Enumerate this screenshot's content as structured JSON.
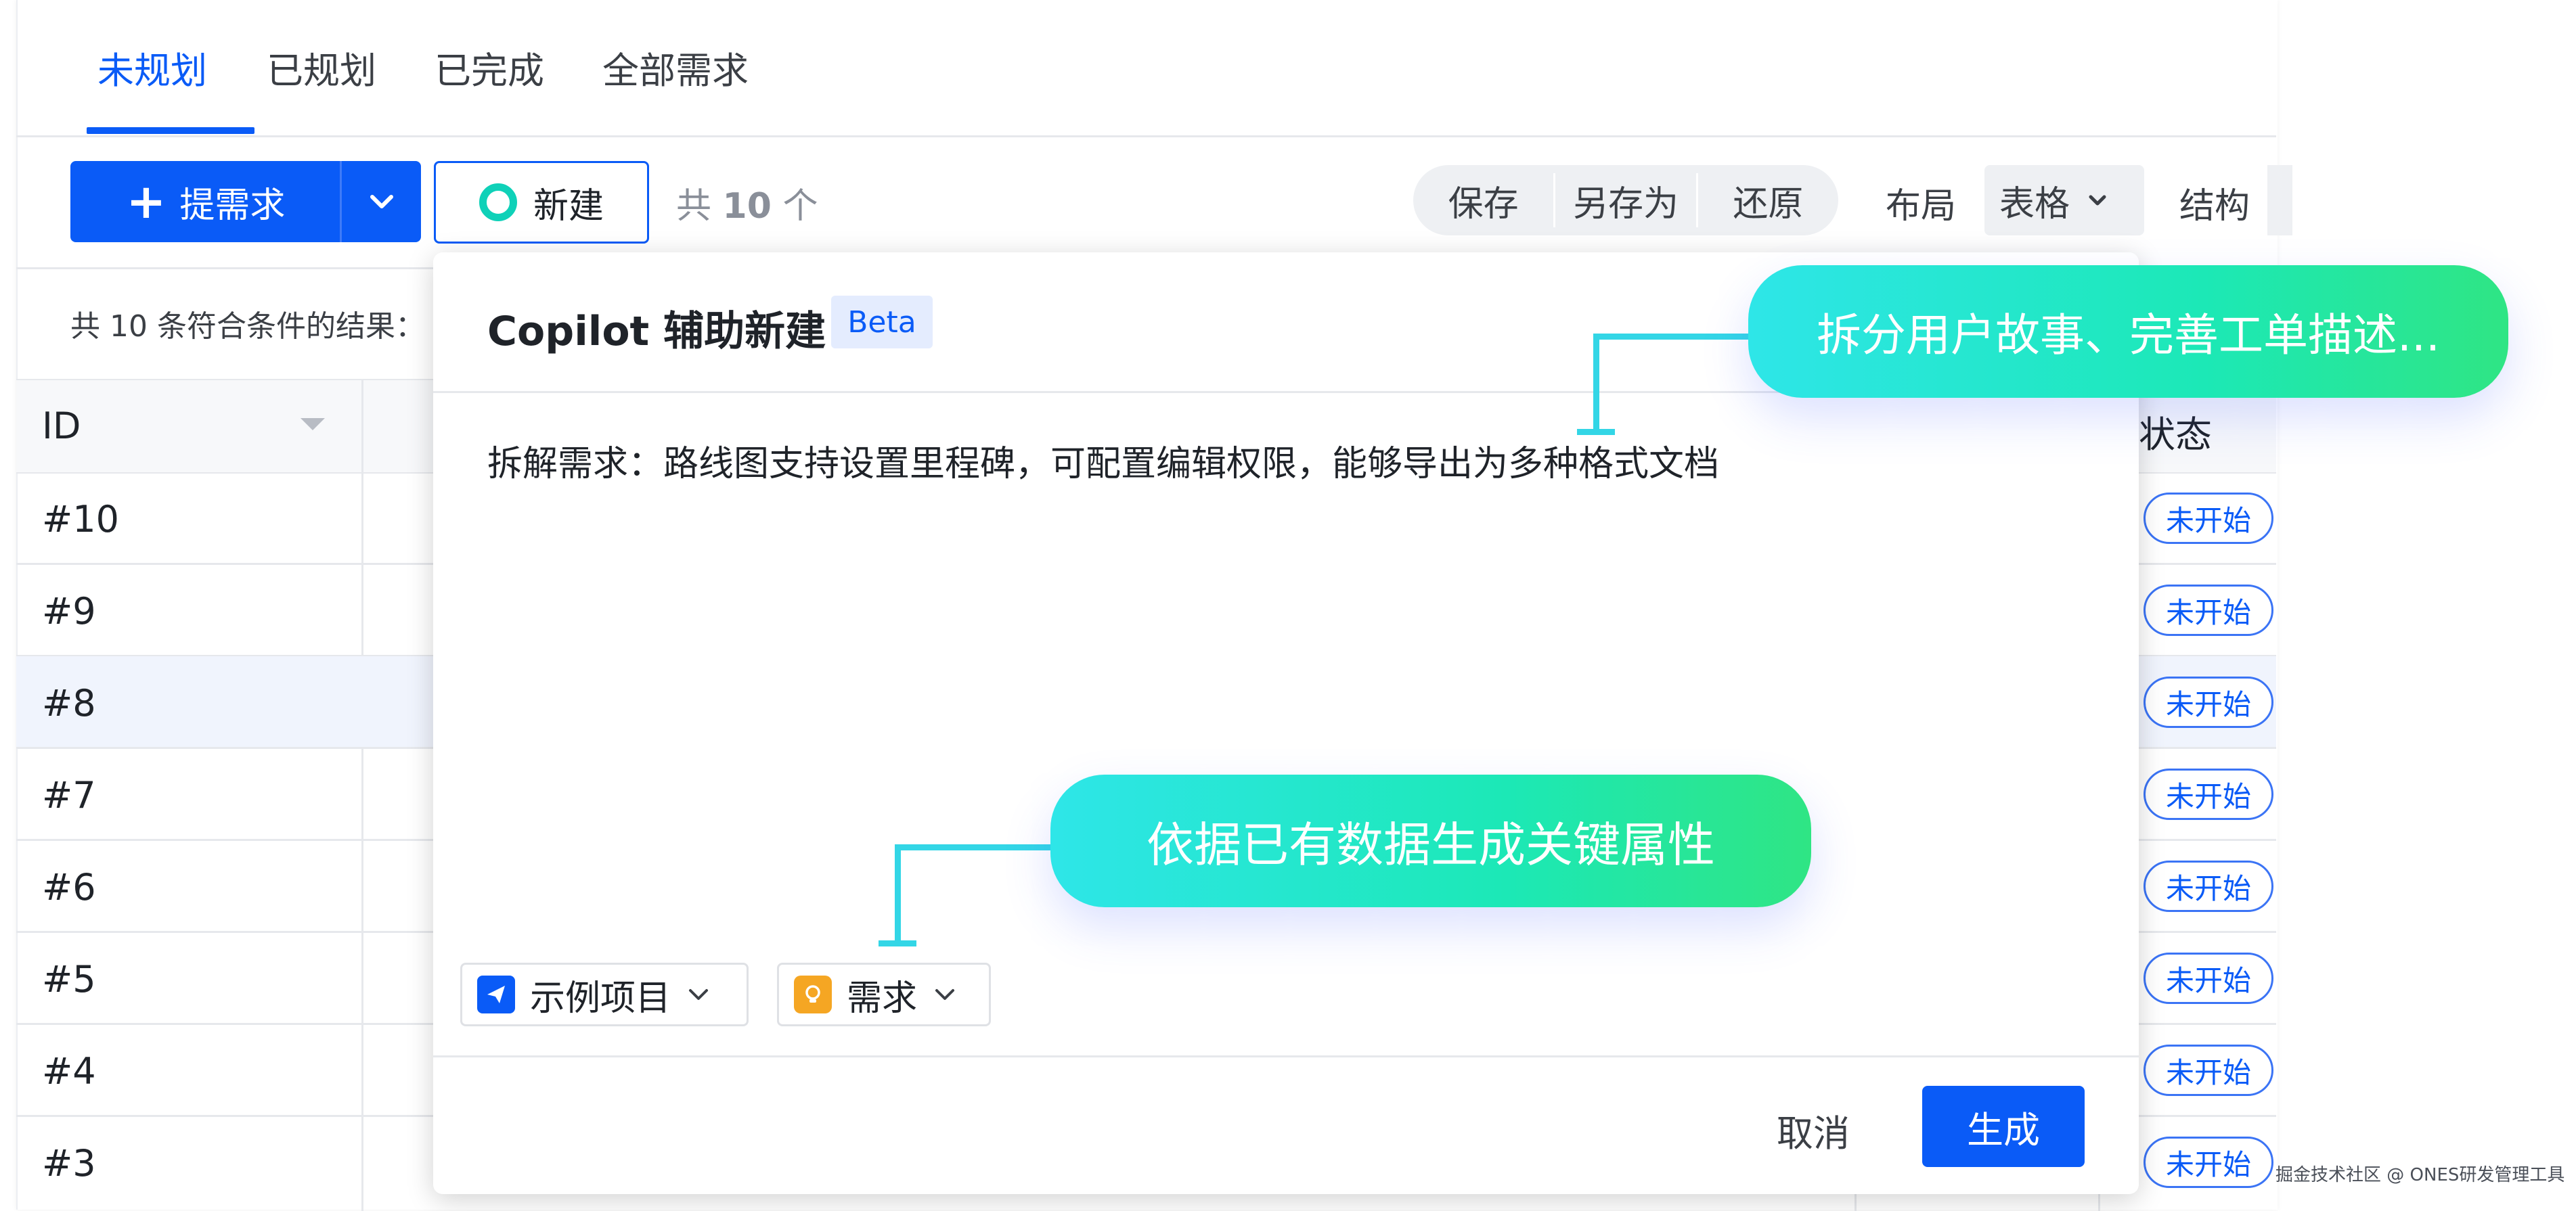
{
  "tabs": [
    {
      "label": "未规划"
    },
    {
      "label": "已规划"
    },
    {
      "label": "已完成"
    },
    {
      "label": "全部需求"
    }
  ],
  "toolbar": {
    "create_label": "提需求",
    "new_label": "新建",
    "count_prefix": "共",
    "count_value": "10",
    "count_suffix": "个",
    "save": "保存",
    "save_as": "另存为",
    "restore": "还原",
    "layout_label": "布局",
    "layout_value": "表格",
    "structure_label": "结构"
  },
  "result_text": "共 10 条符合条件的结果：",
  "table": {
    "col_id": "ID",
    "col_status": "状态",
    "rows": [
      {
        "id": "#10",
        "status": "未开始"
      },
      {
        "id": "#9",
        "status": "未开始"
      },
      {
        "id": "#8",
        "status": "未开始"
      },
      {
        "id": "#7",
        "status": "未开始"
      },
      {
        "id": "#6",
        "status": "未开始"
      },
      {
        "id": "#5",
        "status": "未开始"
      },
      {
        "id": "#4",
        "status": "未开始"
      },
      {
        "id": "#3",
        "status": "未开始"
      }
    ]
  },
  "modal": {
    "title": "Copilot 辅助新建",
    "badge": "Beta",
    "prompt": "拆解需求：路线图支持设置里程碑，可配置编辑权限，能够导出为多种格式文档",
    "project_chip": "示例项目",
    "type_chip": "需求",
    "cancel": "取消",
    "generate": "生成"
  },
  "callouts": {
    "top": "拆分用户故事、完善工单描述...",
    "bottom": "依据已有数据生成关键属性"
  },
  "watermark": "掘金技术社区 @ ONES研发管理工具",
  "colors": {
    "primary": "#0a5bf7",
    "callout_start": "#2ee6e8",
    "callout_end": "#2fe584"
  }
}
